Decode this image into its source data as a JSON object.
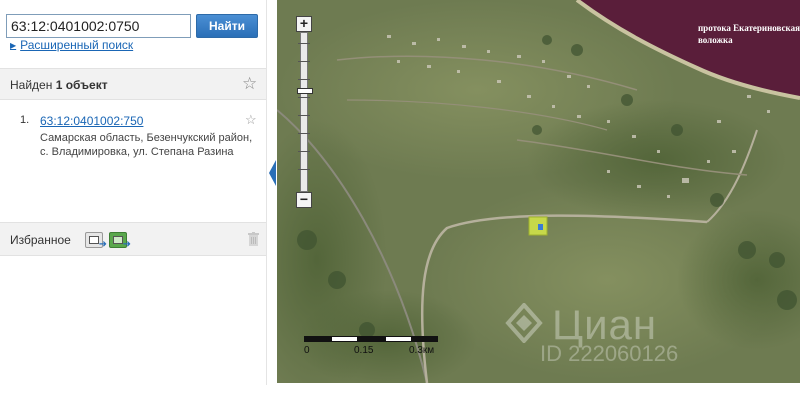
{
  "search": {
    "value": "63:12:0401002:0750",
    "button_label": "Найти",
    "advanced_link": "Расширенный поиск"
  },
  "results": {
    "title_prefix": "Найден",
    "title_bold": "1 объект",
    "items": [
      {
        "number": "1.",
        "cadastral": "63:12:0401002:750",
        "address": "Самарская область, Безенчукский район, с. Владимировка, ул. Степана Разина"
      }
    ]
  },
  "favorites": {
    "label": "Избранное"
  },
  "map": {
    "label_line1": "протока Екатериновская",
    "label_line2": "воложка",
    "zoom_in": "+",
    "zoom_out": "−",
    "scale_labels": [
      "0",
      "0.15",
      "0.3км"
    ],
    "watermark_text": "Циан",
    "watermark_id": "ID 222060126"
  },
  "colors": {
    "accent": "#2a6fb7",
    "link": "#1a66b5",
    "river": "#5a1e3a",
    "plot": "#c6d84a"
  },
  "icons": [
    "star-icon",
    "export-icon",
    "excel-icon",
    "trash-icon",
    "chevron-left-icon"
  ]
}
